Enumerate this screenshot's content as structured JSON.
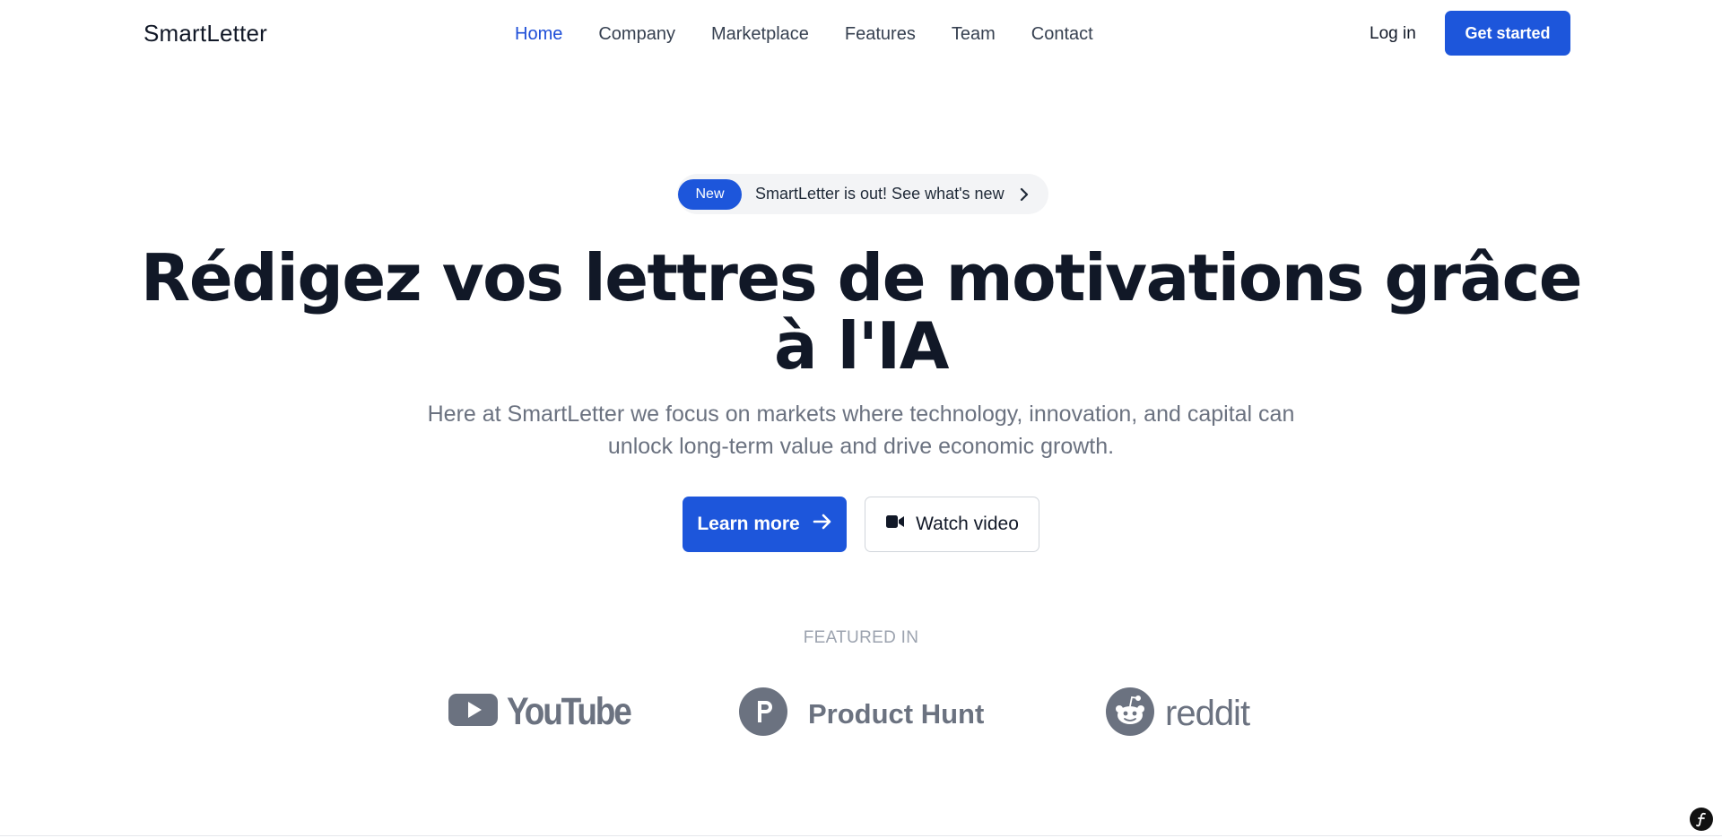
{
  "header": {
    "logo": "SmartLetter",
    "nav": [
      {
        "label": "Home",
        "active": true
      },
      {
        "label": "Company",
        "active": false
      },
      {
        "label": "Marketplace",
        "active": false
      },
      {
        "label": "Features",
        "active": false
      },
      {
        "label": "Team",
        "active": false
      },
      {
        "label": "Contact",
        "active": false
      }
    ],
    "login_label": "Log in",
    "cta_label": "Get started"
  },
  "announcement": {
    "badge": "New",
    "text": "SmartLetter is out! See what's new",
    "icon": "chevron-right-icon"
  },
  "hero": {
    "headline_line1": "Rédigez vos lettres de motivations grâce",
    "headline_line2": "à l'IA",
    "subtitle_line1": "Here at SmartLetter we focus on markets where technology, innovation, and capital can",
    "subtitle_line2": "unlock long-term value and drive economic growth.",
    "primary_button": "Learn more",
    "primary_icon": "arrow-right-icon",
    "secondary_button": "Watch video",
    "secondary_icon": "video-camera-icon"
  },
  "featured": {
    "label": "FEATURED IN",
    "logos": [
      {
        "name": "YouTube",
        "icon": "youtube-icon"
      },
      {
        "name": "Product Hunt",
        "icon": "product-hunt-icon"
      },
      {
        "name": "reddit",
        "icon": "reddit-icon"
      }
    ]
  },
  "colors": {
    "brand_blue": "#1d56db",
    "active_nav": "#1d4ed8",
    "heading": "#111827",
    "muted": "#6b7280",
    "logo_gray": "#6b7280"
  },
  "corner_icon": "symfony-toolbar-icon"
}
